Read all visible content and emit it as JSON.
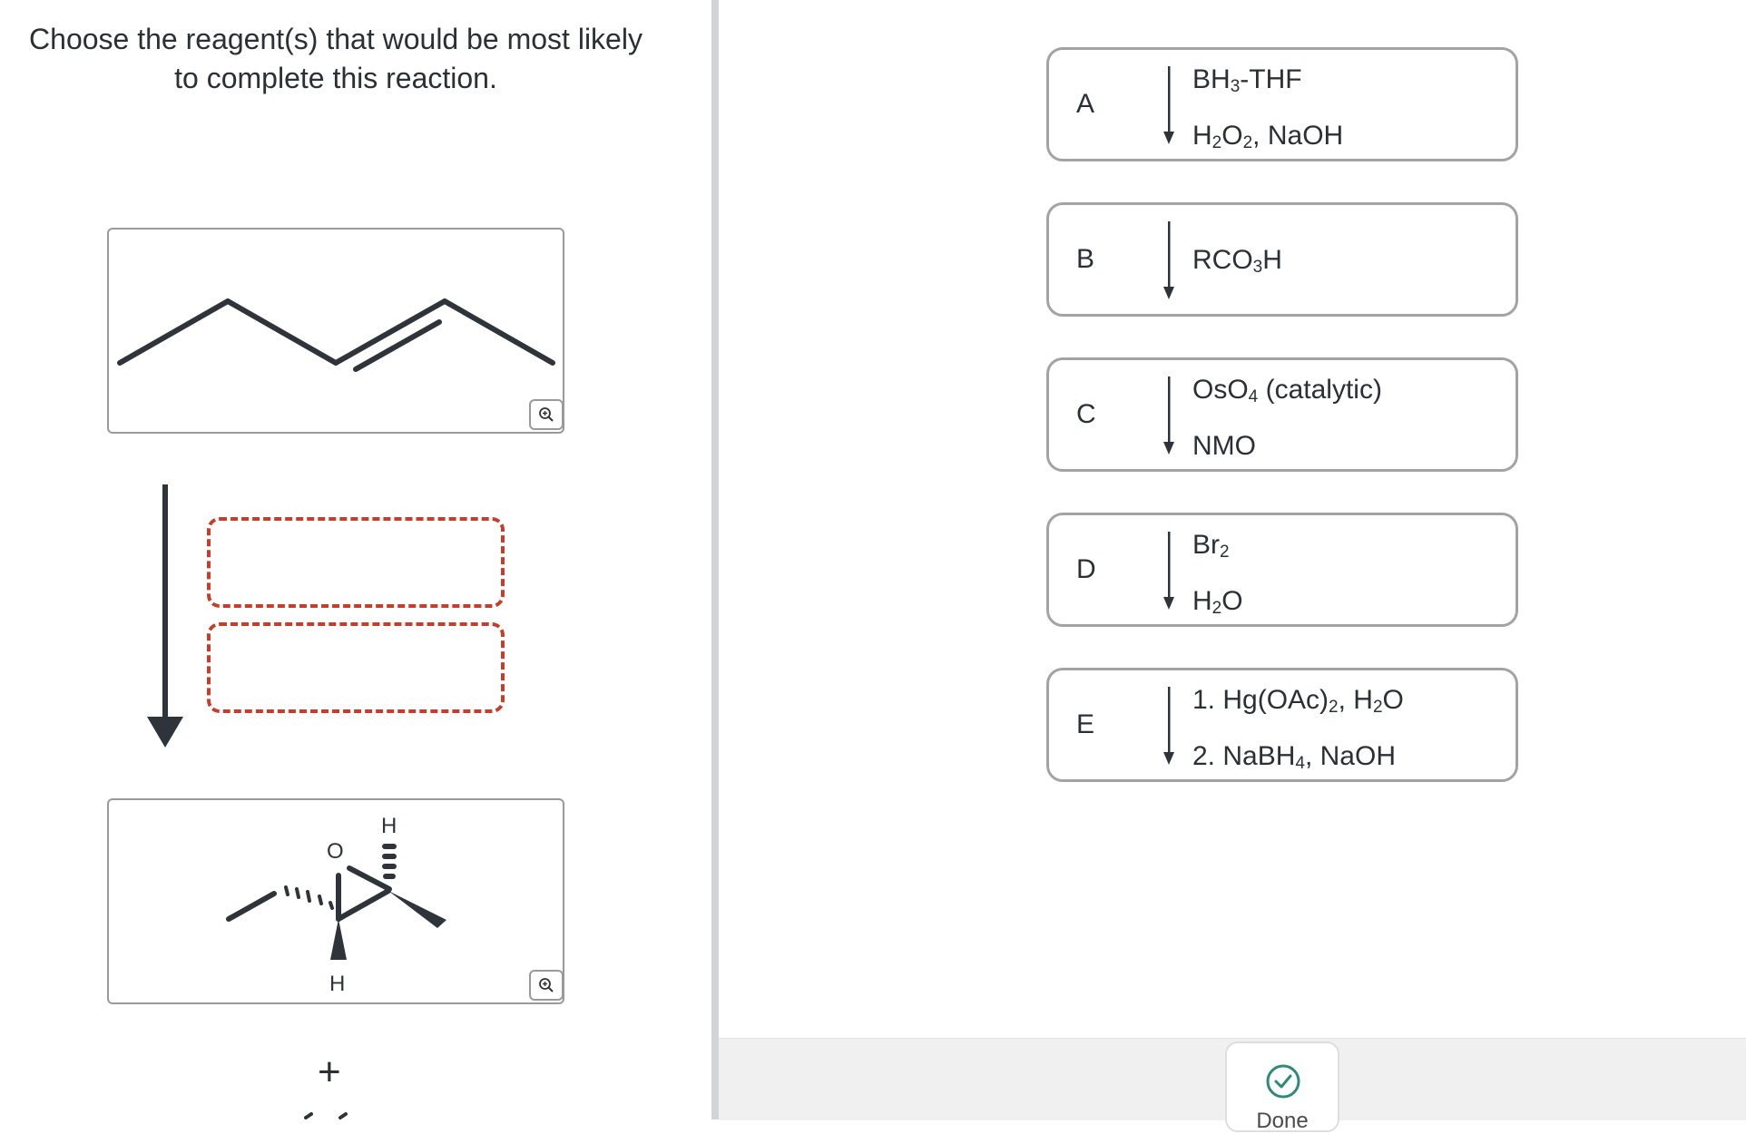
{
  "question": {
    "line1": "Choose the reagent(s) that would be most likely",
    "line2": "to complete this reaction."
  },
  "product": {
    "atom_o": "O",
    "atom_h_top": "H",
    "atom_h_bottom": "H"
  },
  "plus_sign": "+",
  "options": [
    {
      "letter": "A",
      "line1": [
        "BH",
        {
          "sub": "3"
        },
        "-THF"
      ],
      "line2": [
        "H",
        {
          "sub": "2"
        },
        "O",
        {
          "sub": "2"
        },
        ", NaOH"
      ]
    },
    {
      "letter": "B",
      "line1": [
        "RCO",
        {
          "sub": "3"
        },
        "H"
      ],
      "line2": []
    },
    {
      "letter": "C",
      "line1": [
        "OsO",
        {
          "sub": "4"
        },
        " (catalytic)"
      ],
      "line2": [
        "NMO"
      ]
    },
    {
      "letter": "D",
      "line1": [
        "Br",
        {
          "sub": "2"
        }
      ],
      "line2": [
        "H",
        {
          "sub": "2"
        },
        "O"
      ]
    },
    {
      "letter": "E",
      "line1": [
        "1. Hg(OAc)",
        {
          "sub": "2"
        },
        ", H",
        {
          "sub": "2"
        },
        "O"
      ],
      "line2": [
        "2. NaBH",
        {
          "sub": "4"
        },
        ", NaOH"
      ]
    }
  ],
  "done_button": {
    "label": "Done"
  },
  "icons": {
    "zoom": "zoom-in-icon",
    "done": "check-circle-icon",
    "reaction_arrow": "arrow-down-icon"
  },
  "colors": {
    "drop_slot_border": "#c43e2c",
    "done_accent": "#2e8b7a",
    "bond": "#2f343b"
  }
}
